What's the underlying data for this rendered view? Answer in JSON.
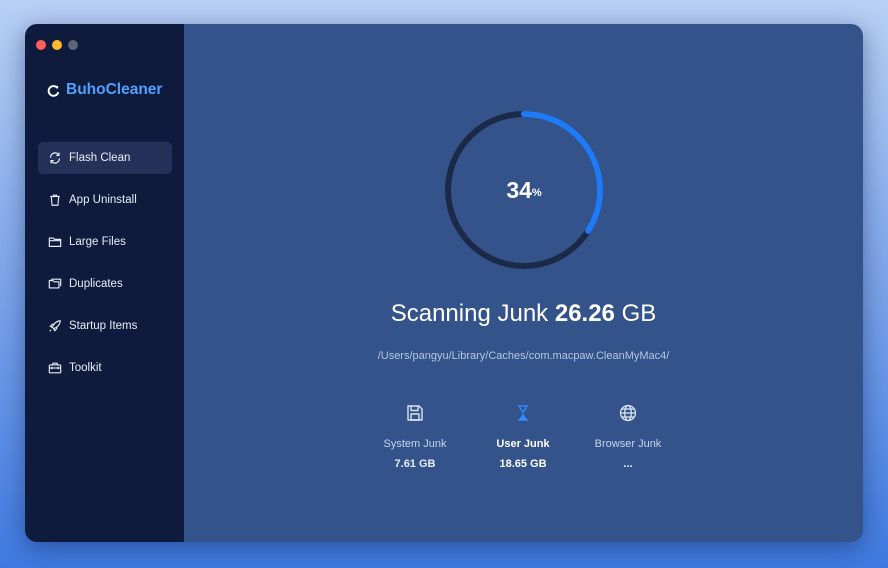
{
  "app": {
    "name": "BuhoCleaner",
    "brand_color": "#4fa0ff"
  },
  "window_controls": [
    "close",
    "minimize",
    "zoom"
  ],
  "sidebar": {
    "items": [
      {
        "label": "Flash Clean",
        "icon": "refresh-icon",
        "active": true
      },
      {
        "label": "App Uninstall",
        "icon": "trash-icon",
        "active": false
      },
      {
        "label": "Large Files",
        "icon": "folder-icon",
        "active": false
      },
      {
        "label": "Duplicates",
        "icon": "duplicate-folder-icon",
        "active": false
      },
      {
        "label": "Startup Items",
        "icon": "rocket-icon",
        "active": false
      },
      {
        "label": "Toolkit",
        "icon": "toolkit-icon",
        "active": false
      }
    ]
  },
  "progress": {
    "value": 34,
    "unit": "%",
    "color": "#1e7bf5",
    "track_color": "#1c2a4a"
  },
  "scan": {
    "prefix": "Scanning Junk",
    "size_value": "26.26",
    "size_unit": "GB",
    "path": "/Users/pangyu/Library/Caches/com.macpaw.CleanMyMac4/"
  },
  "categories": [
    {
      "label": "System Junk",
      "size": "7.61 GB",
      "icon": "floppy-disk-icon",
      "active": false
    },
    {
      "label": "User Junk",
      "size": "18.65 GB",
      "icon": "hourglass-icon",
      "active": true
    },
    {
      "label": "Browser Junk",
      "size": "...",
      "icon": "globe-icon",
      "active": false
    }
  ]
}
